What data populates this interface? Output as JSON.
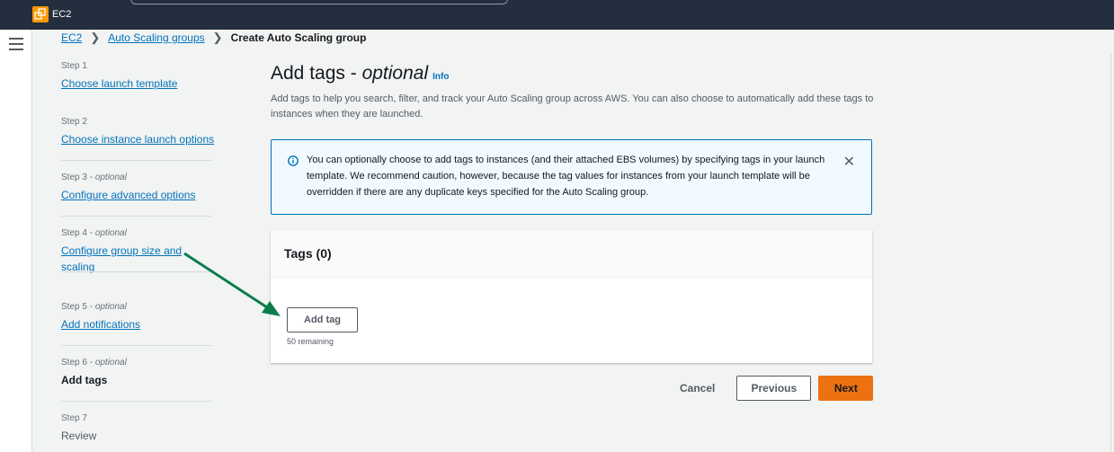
{
  "topbar": {
    "service": "EC2"
  },
  "breadcrumb": [
    {
      "label": "EC2"
    },
    {
      "label": "Auto Scaling groups"
    },
    {
      "label": "Create Auto Scaling group"
    }
  ],
  "steps": [
    {
      "num": "Step 1",
      "opt": "",
      "label": "Choose launch template"
    },
    {
      "num": "Step 2",
      "opt": "",
      "label": "Choose instance launch options"
    },
    {
      "num": "Step 3 - ",
      "opt": "optional",
      "label": "Configure advanced options"
    },
    {
      "num": "Step 4 - ",
      "opt": "optional",
      "label": "Configure group size and scaling"
    },
    {
      "num": "Step 5 - ",
      "opt": "optional",
      "label": "Add notifications"
    },
    {
      "num": "Step 6 - ",
      "opt": "optional",
      "label": "Add tags"
    },
    {
      "num": "Step 7",
      "opt": "",
      "label": "Review"
    }
  ],
  "page": {
    "title": "Add tags - ",
    "title_italic": "optional",
    "info": "Info",
    "description": "Add tags to help you search, filter, and track your Auto Scaling group across AWS. You can also choose to automatically add these tags to instances when they are launched."
  },
  "alert": {
    "text": "You can optionally choose to add tags to instances (and their attached EBS volumes) by specifying tags in your launch template. We recommend caution, however, because the tag values for instances from your launch template will be overridden if there are any duplicate keys specified for the Auto Scaling group."
  },
  "tags": {
    "header": "Tags (0)",
    "add_label": "Add tag",
    "remaining": "50 remaining"
  },
  "actions": {
    "cancel": "Cancel",
    "previous": "Previous",
    "next": "Next"
  },
  "colors": {
    "topbar": "#232f3e",
    "link": "#0073bb",
    "primary": "#ec7211",
    "arrow": "#0a7d4a"
  }
}
